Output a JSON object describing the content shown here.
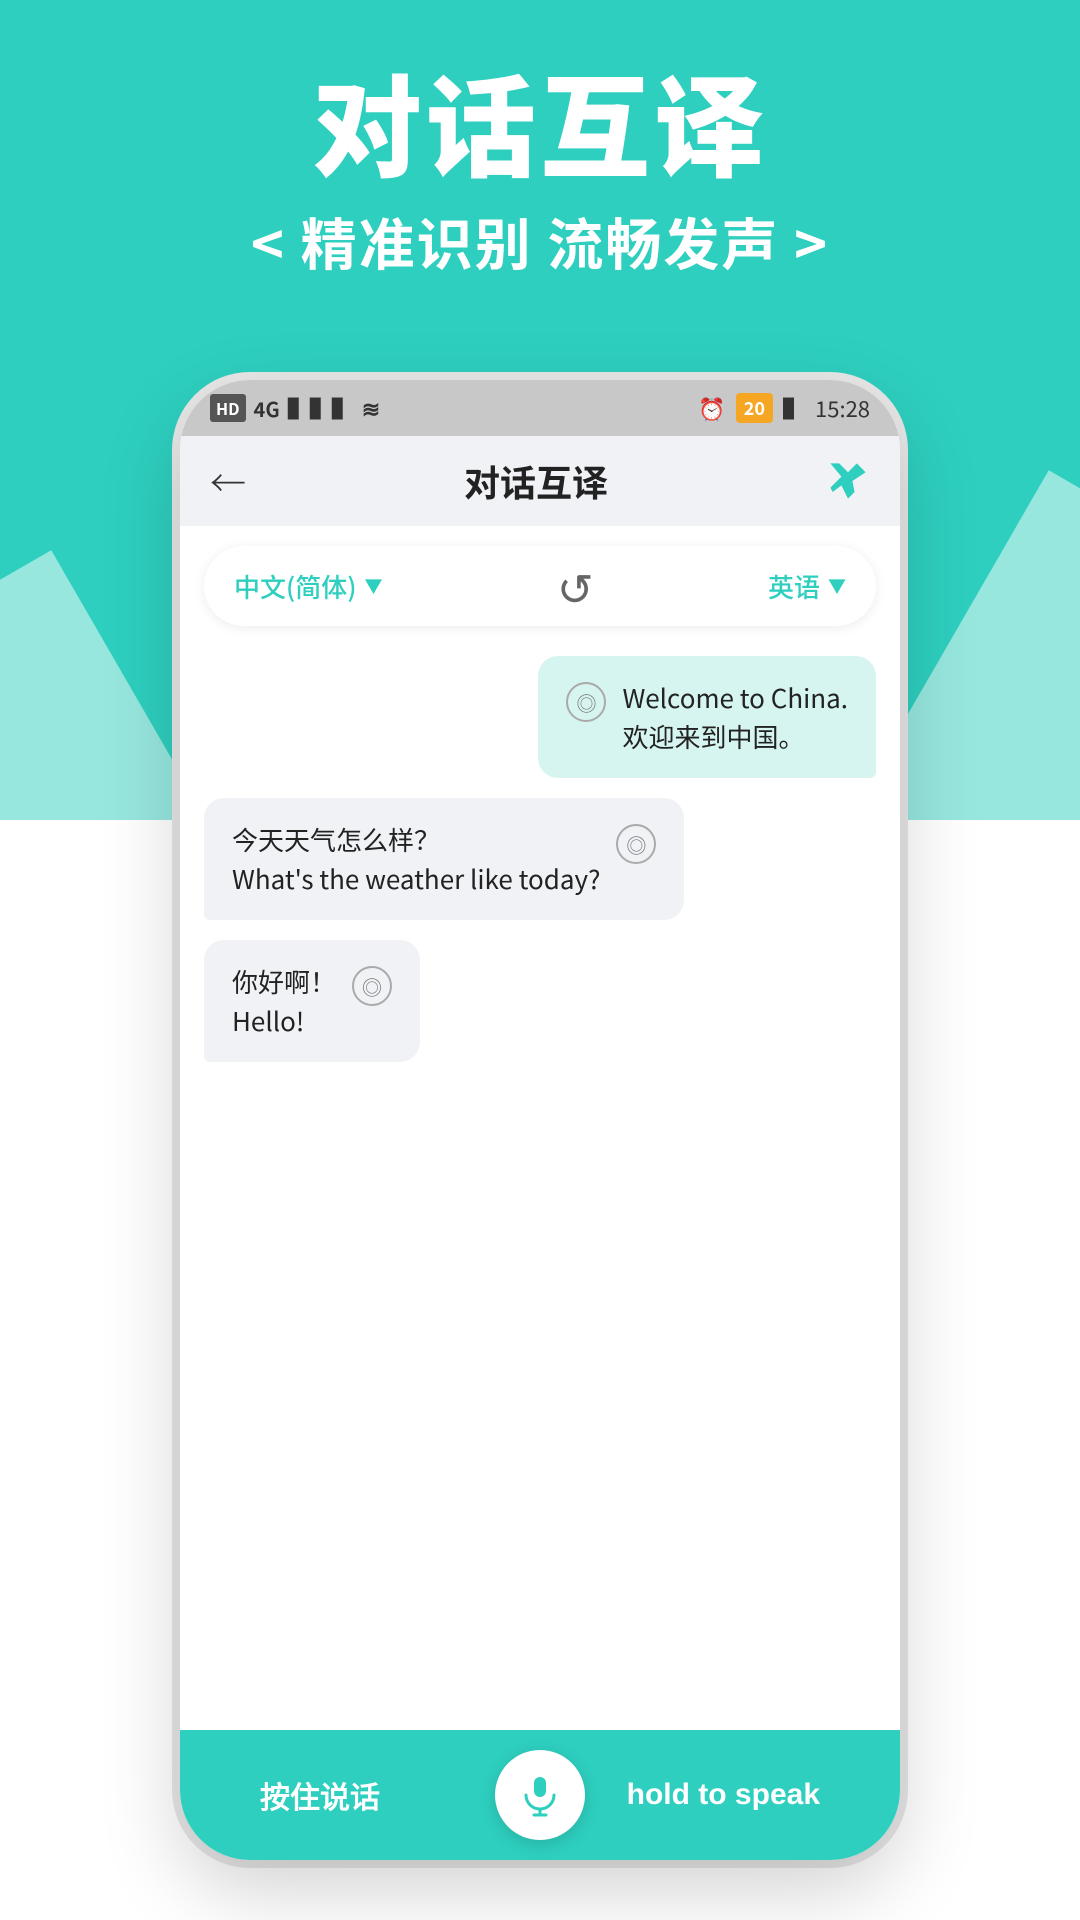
{
  "page": {
    "background_color": "#2ECFBF",
    "main_title": "对话互译",
    "sub_title": "< 精准识别   流畅发声 >"
  },
  "status_bar": {
    "left_items": [
      "HD",
      "4G",
      "signal",
      "wifi"
    ],
    "alarm": "alarm",
    "battery": "20",
    "time": "15:28"
  },
  "app_header": {
    "back_label": "←",
    "title": "对话互译",
    "pin_label": "pin"
  },
  "lang_bar": {
    "lang_left": "中文(简体)",
    "lang_left_arrow": "▼",
    "swap_icon": "↺",
    "lang_right": "英语",
    "lang_right_arrow": "▼"
  },
  "chat": {
    "messages": [
      {
        "side": "right",
        "line1": "Welcome to China.",
        "line2": "欢迎来到中国。"
      },
      {
        "side": "left",
        "line1": "今天天气怎么样？",
        "line2": "What's the weather like today?"
      },
      {
        "side": "left",
        "line1": "你好啊！",
        "line2": "Hello!"
      }
    ]
  },
  "bottom_bar": {
    "left_btn": "按住说话",
    "right_btn": "hold to speak",
    "mic_label": "microphone"
  }
}
